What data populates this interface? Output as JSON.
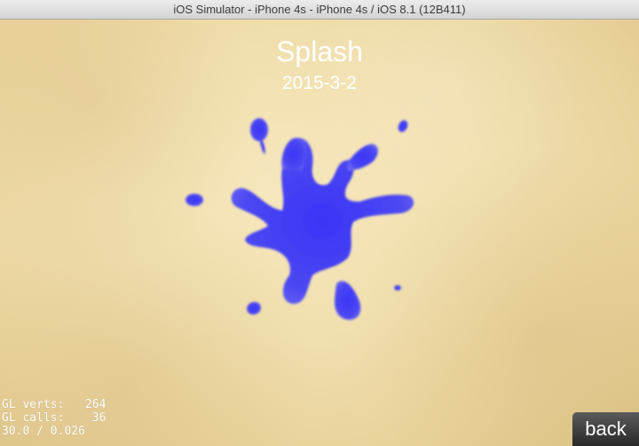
{
  "window": {
    "title": "iOS Simulator - iPhone 4s - iPhone 4s / iOS 8.1 (12B411)"
  },
  "scene": {
    "title": "Splash",
    "date": "2015-3-2"
  },
  "stats": {
    "line1": "GL verts:   264",
    "line2": "GL calls:    36",
    "line3": "30.0 / 0.026"
  },
  "back_label": "back",
  "colors": {
    "splat": "#4a45f2",
    "background": "#f1dfae"
  }
}
